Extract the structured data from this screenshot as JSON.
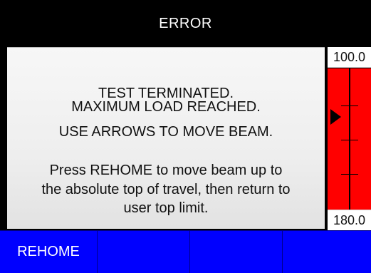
{
  "header": {
    "title": "ERROR"
  },
  "message": {
    "lines": [
      "TEST TERMINATED.",
      "MAXIMUM LOAD REACHED.",
      "USE ARROWS TO MOVE BEAM.",
      "Press REHOME to move beam up to",
      "the absolute top of travel, then return to",
      "user top limit."
    ]
  },
  "gauge": {
    "top_value": "100.0",
    "bottom_value": "180.0",
    "bar_color": "#ff0000"
  },
  "softkeys": [
    {
      "label": "REHOME"
    },
    {
      "label": ""
    },
    {
      "label": ""
    },
    {
      "label": ""
    }
  ],
  "colors": {
    "header_bg": "#000000",
    "softkey_bg": "#0000ff",
    "panel_bg": "#eeeeee"
  }
}
